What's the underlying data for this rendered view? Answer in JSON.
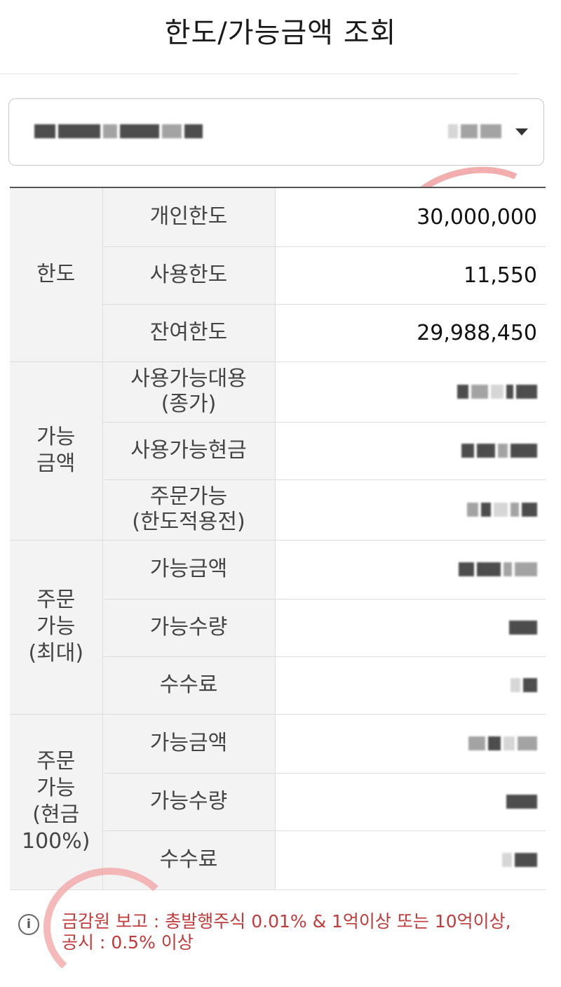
{
  "header": {
    "title": "한도/가능금액 조회"
  },
  "account_selector": {
    "masked": true
  },
  "groups": [
    {
      "label": "한도",
      "rows": [
        {
          "label": "개인한도",
          "value": "30,000,000"
        },
        {
          "label": "사용한도",
          "value": "11,550"
        },
        {
          "label": "잔여한도",
          "value": "29,988,450"
        }
      ]
    },
    {
      "label": "가능\n금액",
      "rows": [
        {
          "label": "사용가능대용\n(종가)",
          "value": ""
        },
        {
          "label": "사용가능현금",
          "value": ""
        },
        {
          "label": "주문가능\n(한도적용전)",
          "value": ""
        }
      ]
    },
    {
      "label": "주문\n가능\n(최대)",
      "rows": [
        {
          "label": "가능금액",
          "value": ""
        },
        {
          "label": "가능수량",
          "value": ""
        },
        {
          "label": "수수료",
          "value": ""
        }
      ]
    },
    {
      "label": "주문\n가능\n(현금\n100%)",
      "rows": [
        {
          "label": "가능금액",
          "value": ""
        },
        {
          "label": "가능수량",
          "value": ""
        },
        {
          "label": "수수료",
          "value": ""
        }
      ]
    }
  ],
  "footer": {
    "icon": "info-icon",
    "notice": "금감원 보고 : 총발행주식 0.01% & 1억이상 또는 10억이상,\n공시 : 0.5% 이상"
  },
  "colors": {
    "notice": "#c33a3a",
    "label_bg": "#f3f3f3",
    "annotation": "#f0a0a0"
  }
}
